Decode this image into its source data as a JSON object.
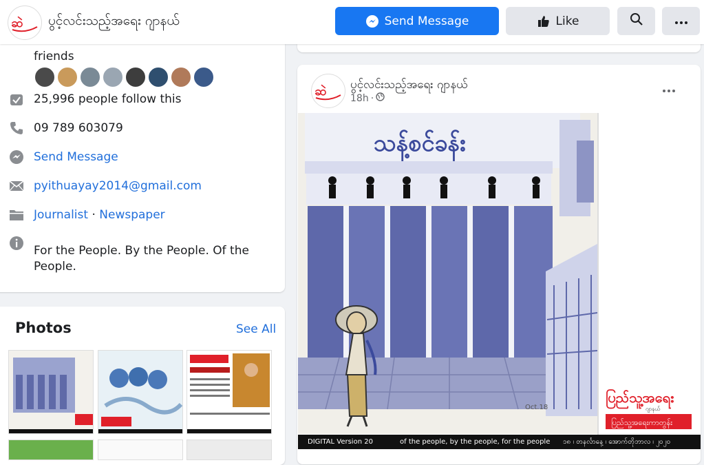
{
  "header": {
    "page_name": "ပွင့်လင်းသည့်အရေး ဂျာနယ်",
    "send_message": "Send Message",
    "like": "Like"
  },
  "about": {
    "friends_text": "friends",
    "followers": "25,996 people follow this",
    "phone": "09 789 603079",
    "send_message": "Send Message",
    "email": "pyithuayay2014@gmail.com",
    "category_1": "Journalist",
    "category_sep": " · ",
    "category_2": "Newspaper",
    "description_line1": "For the People. By the People. Of the",
    "description_line2": "People."
  },
  "photos": {
    "title": "Photos",
    "see_all": "See All"
  },
  "post": {
    "page_name": "ပွင့်လင်းသည့်အရေး ဂျာနယ်",
    "time": "18h",
    "separator": "·",
    "cartoon_title": "သန့်စင်ခန်း",
    "caption_left": "DIGITAL Version  20",
    "caption_mid": "of the people, by the people, for the people",
    "caption_right": "၁၈ ၊ တနင်္လာနေ့ ၊ အောက်တိုဘာလ ၊ ၂၀၂၀",
    "brand_text": "ပြည်သူ့အရေး",
    "brand_sub": "ဂျာနယ်",
    "brand_tag": "ပြည်သူ့အရေးကာတွန်း"
  },
  "colors": {
    "accent": "#1877f2",
    "link": "#216fdb",
    "brand_red": "#e0202a",
    "cartoon_blue": "#6a74b5"
  },
  "icons": [
    "messenger-icon",
    "thumbs-up-icon",
    "search-icon",
    "more-icon",
    "check-box-icon",
    "phone-icon",
    "messenger-icon",
    "mail-icon",
    "folder-icon",
    "info-icon",
    "globe-icon"
  ]
}
